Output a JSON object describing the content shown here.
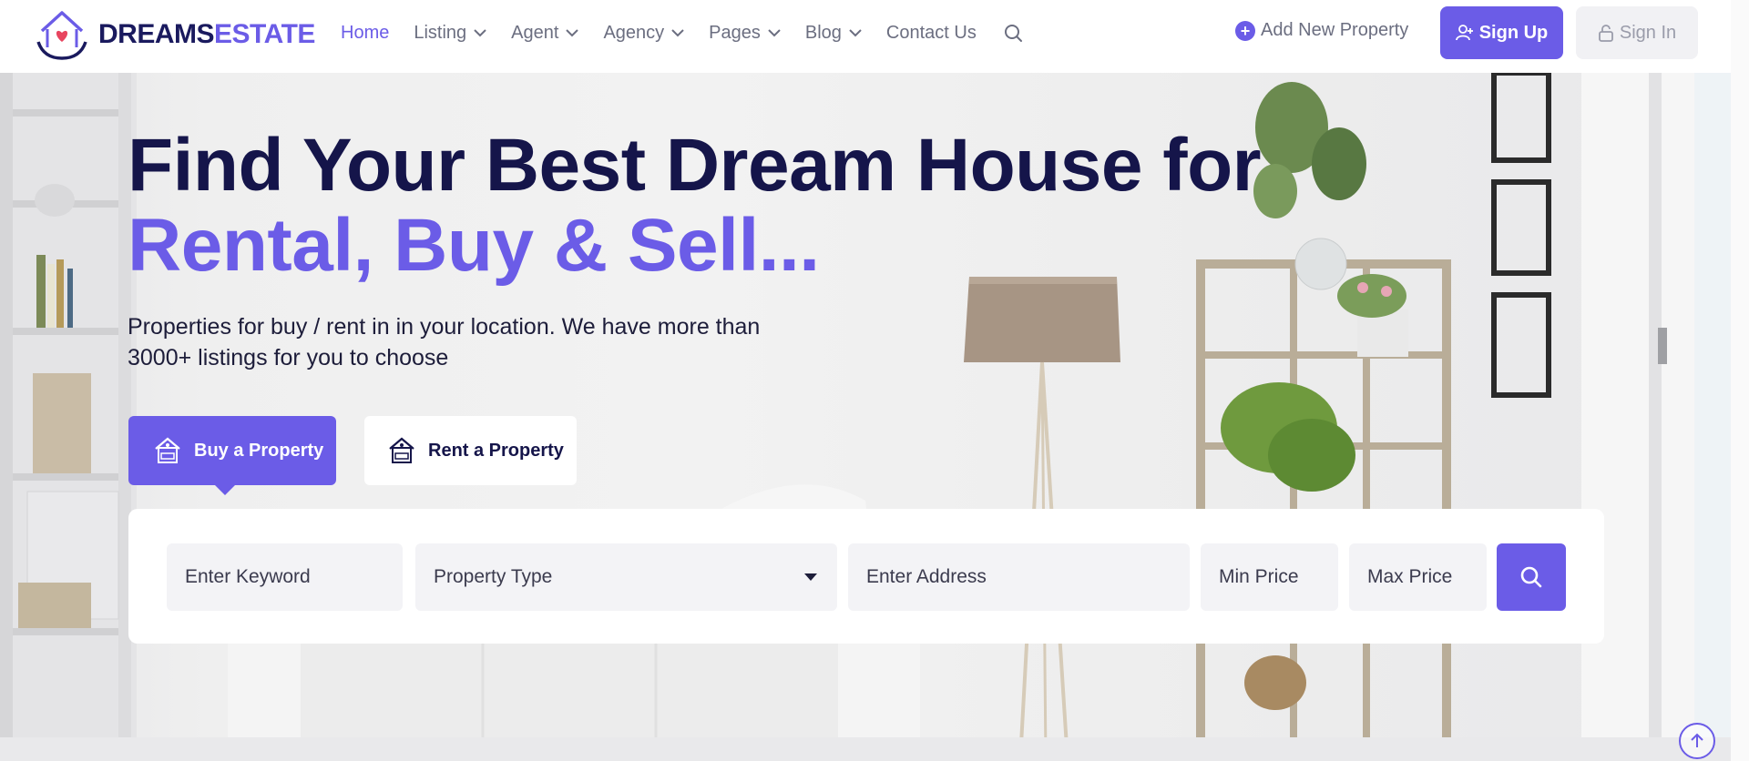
{
  "brand": {
    "name_part1": "DREAMS",
    "name_part2": "ESTATE",
    "accent_color": "#6b5ce7",
    "dark_color": "#15154a"
  },
  "nav": {
    "items": [
      {
        "label": "Home",
        "active": true,
        "has_dropdown": false
      },
      {
        "label": "Listing",
        "active": false,
        "has_dropdown": true
      },
      {
        "label": "Agent",
        "active": false,
        "has_dropdown": true
      },
      {
        "label": "Agency",
        "active": false,
        "has_dropdown": true
      },
      {
        "label": "Pages",
        "active": false,
        "has_dropdown": true
      },
      {
        "label": "Blog",
        "active": false,
        "has_dropdown": true
      },
      {
        "label": "Contact Us",
        "active": false,
        "has_dropdown": false
      }
    ],
    "search_icon": "search-icon"
  },
  "header_actions": {
    "add_property": "Add New Property",
    "sign_up": "Sign Up",
    "sign_in": "Sign In"
  },
  "hero": {
    "title_line1": "Find Your Best Dream House for",
    "title_line2": "Rental, Buy & Sell...",
    "subtitle": "Properties for buy / rent in in your location. We have more than 3000+ listings for you to choose"
  },
  "tabs": {
    "buy": "Buy a Property",
    "rent": "Rent a Property",
    "active": "buy"
  },
  "search": {
    "keyword_placeholder": "Enter Keyword",
    "property_type": "Property Type",
    "address_placeholder": "Enter Address",
    "min_price_placeholder": "Min Price",
    "max_price_placeholder": "Max Price"
  }
}
